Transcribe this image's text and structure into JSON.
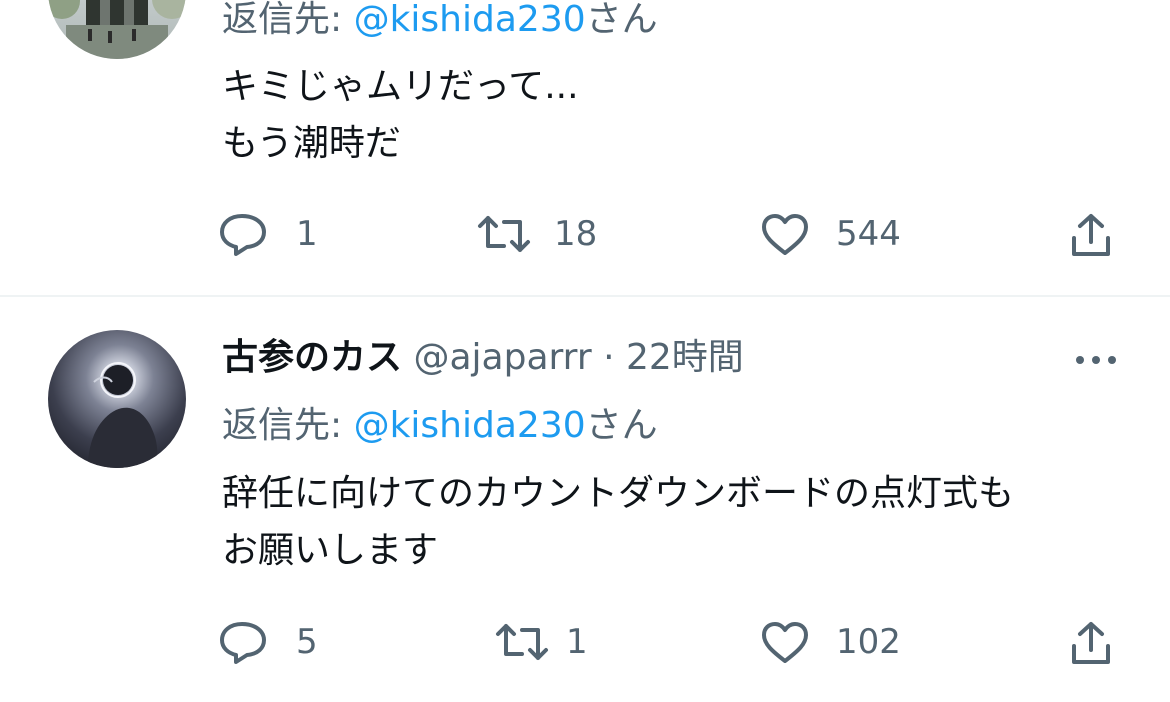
{
  "tweets": [
    {
      "reply_prefix": "返信先: ",
      "reply_mention": "@kishida230",
      "reply_suffix": "さん",
      "body_lines": [
        "キミじゃムリだって...",
        "もう潮時だ"
      ],
      "counts": {
        "replies": "1",
        "retweets": "18",
        "likes": "544"
      }
    },
    {
      "display_name": "古参のカス",
      "handle": "@ajaparrr",
      "separator": "·",
      "time": "22時間",
      "reply_prefix": "返信先: ",
      "reply_mention": "@kishida230",
      "reply_suffix": "さん",
      "body_lines": [
        "辞任に向けてのカウントダウンボードの点灯式も",
        "お願いします"
      ],
      "counts": {
        "replies": "5",
        "retweets": "1",
        "likes": "102"
      }
    }
  ],
  "icons": {
    "reply": "reply-icon",
    "retweet": "retweet-icon",
    "like": "heart-icon",
    "share": "share-icon",
    "more": "more-icon"
  },
  "colors": {
    "link": "#1d9bf0",
    "secondary_text": "#536471",
    "primary_text": "#0f1419",
    "divider": "#eff3f4"
  }
}
